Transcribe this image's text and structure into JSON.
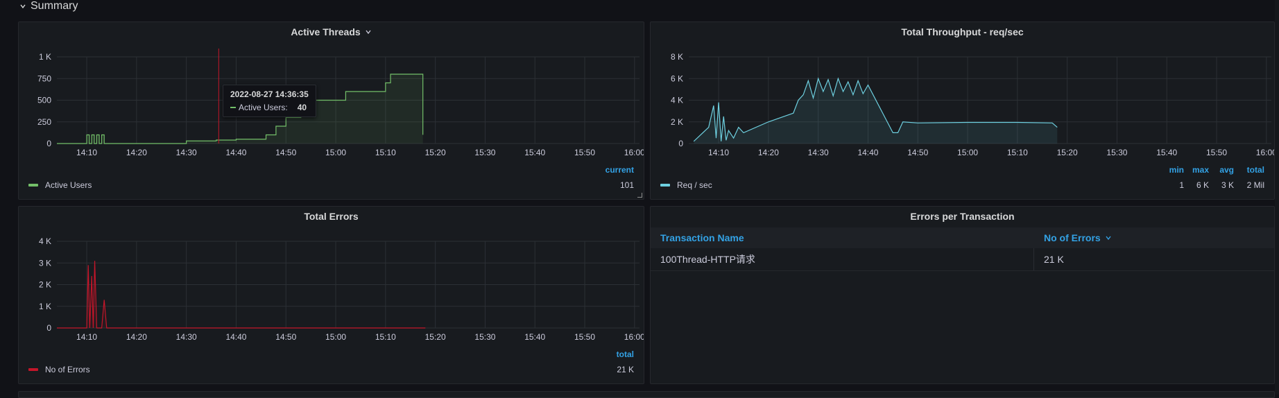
{
  "row": {
    "title": "Summary"
  },
  "panels": {
    "active_threads": {
      "title": "Active Threads",
      "legend_header": "current",
      "legend": [
        {
          "name": "Active Users",
          "current": "101",
          "color": "#73bf69"
        }
      ],
      "tooltip": {
        "time": "2022-08-27 14:36:35",
        "series": "Active Users:",
        "value": "40"
      }
    },
    "throughput": {
      "title": "Total Throughput - req/sec",
      "legend_headers": [
        "min",
        "max",
        "avg",
        "total"
      ],
      "legend": [
        {
          "name": "Req / sec",
          "min": "1",
          "max": "6 K",
          "avg": "3 K",
          "total": "2 Mil",
          "color": "#6ed0e0"
        }
      ]
    },
    "total_errors": {
      "title": "Total Errors",
      "legend_header": "total",
      "legend": [
        {
          "name": "No of Errors",
          "total": "21 K",
          "color": "#c4162a"
        }
      ]
    },
    "errors_per_transaction": {
      "title": "Errors per Transaction",
      "columns": [
        "Transaction Name",
        "No of Errors"
      ],
      "rows": [
        [
          "100Thread-HTTP请求",
          "21 K"
        ]
      ]
    }
  },
  "chart_data": [
    {
      "type": "line",
      "title": "Active Threads",
      "x_ticks": [
        "14:10",
        "14:20",
        "14:30",
        "14:40",
        "14:50",
        "15:00",
        "15:10",
        "15:20",
        "15:30",
        "15:40",
        "15:50",
        "16:00"
      ],
      "y_ticks": [
        "0",
        "250",
        "500",
        "750",
        "1 K"
      ],
      "ylim": [
        0,
        1000
      ],
      "xlim": [
        "14:04",
        "16:01"
      ],
      "grid": true,
      "legend": "bottom-left",
      "series": [
        {
          "name": "Active Users",
          "x": [
            "14:04",
            "14:09",
            "14:10",
            "14:10.5",
            "14:11",
            "14:11.5",
            "14:12",
            "14:12.5",
            "14:13",
            "14:13.5",
            "14:14",
            "14:20",
            "14:30",
            "14:36",
            "14:40",
            "14:46",
            "14:48",
            "14:50",
            "14:52",
            "14:53",
            "14:55",
            "14:56",
            "15:00",
            "15:02",
            "15:05",
            "15:10",
            "15:11",
            "15:17",
            "15:17.5"
          ],
          "y": [
            0,
            0,
            100,
            0,
            100,
            0,
            100,
            0,
            100,
            0,
            0,
            0,
            30,
            40,
            50,
            100,
            200,
            300,
            300,
            400,
            400,
            500,
            500,
            600,
            600,
            700,
            800,
            800,
            101
          ]
        }
      ]
    },
    {
      "type": "line",
      "title": "Total Throughput - req/sec",
      "x_ticks": [
        "14:10",
        "14:20",
        "14:30",
        "14:40",
        "14:50",
        "15:00",
        "15:10",
        "15:20",
        "15:30",
        "15:40",
        "15:50",
        "16:00"
      ],
      "y_ticks": [
        "0",
        "2 K",
        "4 K",
        "6 K",
        "8 K"
      ],
      "ylim": [
        0,
        8000
      ],
      "xlim": [
        "14:04",
        "16:01"
      ],
      "grid": true,
      "legend": "bottom-left",
      "series": [
        {
          "name": "Req / sec",
          "x": [
            "14:05",
            "14:08",
            "14:09",
            "14:09.5",
            "14:10",
            "14:10.5",
            "14:11",
            "14:11.5",
            "14:12",
            "14:13",
            "14:14",
            "14:15",
            "14:20",
            "14:25",
            "14:26",
            "14:27",
            "14:28",
            "14:29",
            "14:30",
            "14:31",
            "14:32",
            "14:33",
            "14:34",
            "14:35",
            "14:36",
            "14:37",
            "14:38",
            "14:39",
            "14:40",
            "14:45",
            "14:46",
            "14:47",
            "14:50",
            "15:00",
            "15:10",
            "15:17",
            "15:18"
          ],
          "y": [
            200,
            1500,
            3500,
            500,
            3800,
            200,
            2500,
            300,
            1200,
            500,
            1500,
            1000,
            2000,
            2800,
            4000,
            4500,
            5800,
            4200,
            6000,
            4800,
            5900,
            4400,
            6000,
            4800,
            5700,
            4500,
            5800,
            4600,
            5400,
            1000,
            1000,
            2000,
            1900,
            1950,
            1950,
            1900,
            1500
          ]
        }
      ]
    },
    {
      "type": "line",
      "title": "Total Errors",
      "x_ticks": [
        "14:10",
        "14:20",
        "14:30",
        "14:40",
        "14:50",
        "15:00",
        "15:10",
        "15:20",
        "15:30",
        "15:40",
        "15:50",
        "16:00"
      ],
      "y_ticks": [
        "0",
        "1 K",
        "2 K",
        "3 K",
        "4 K"
      ],
      "ylim": [
        0,
        4000
      ],
      "xlim": [
        "14:04",
        "16:01"
      ],
      "grid": true,
      "legend": "bottom-left",
      "series": [
        {
          "name": "No of Errors",
          "x": [
            "14:04",
            "14:09",
            "14:10",
            "14:10.3",
            "14:10.6",
            "14:11",
            "14:11.3",
            "14:11.6",
            "14:12",
            "14:12.3",
            "14:12.6",
            "14:13",
            "14:13.5",
            "14:14",
            "14:20",
            "15:00",
            "15:18"
          ],
          "y": [
            0,
            0,
            0,
            2900,
            0,
            2400,
            0,
            3100,
            0,
            0,
            0,
            0,
            1300,
            0,
            0,
            0,
            0
          ]
        }
      ]
    }
  ]
}
